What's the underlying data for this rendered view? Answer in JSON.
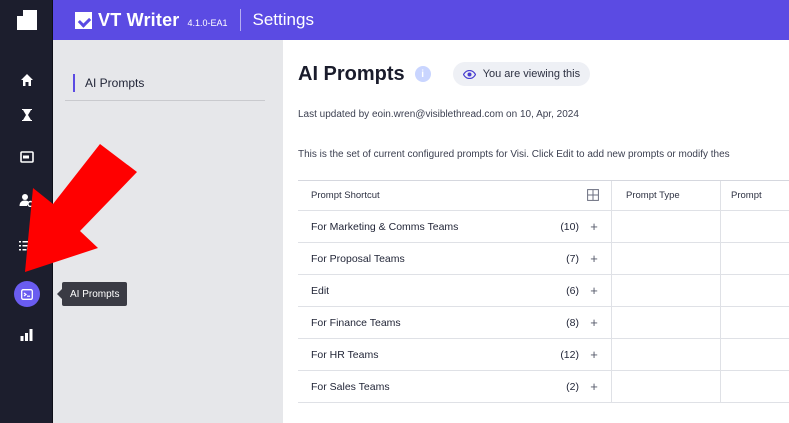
{
  "app": {
    "name": "VT Writer",
    "version": "4.1.0-EA1",
    "section": "Settings"
  },
  "rail": {
    "items": [
      {
        "icon": "home-icon"
      },
      {
        "icon": "hourglass-icon"
      },
      {
        "icon": "document-icon"
      },
      {
        "icon": "user-settings-icon"
      },
      {
        "icon": "list-search-icon"
      },
      {
        "icon": "terminal-icon",
        "active": true
      },
      {
        "icon": "bar-chart-icon"
      }
    ],
    "tooltip": "AI Prompts"
  },
  "subnav": {
    "items": [
      {
        "label": "AI Prompts",
        "active": true
      }
    ]
  },
  "page": {
    "title": "AI Prompts",
    "info_symbol": "i",
    "view_badge": "You are viewing this",
    "last_updated": "Last updated by eoin.wren@visiblethread.com on 10, Apr, 2024",
    "description": "This is the set of current configured prompts for Visi. Click Edit to add new prompts or modify thes"
  },
  "table": {
    "headers": {
      "shortcut": "Prompt Shortcut",
      "type": "Prompt Type",
      "prompt": "Prompt"
    },
    "rows": [
      {
        "name": "For Marketing & Comms Teams",
        "count": "(10)",
        "action": "+"
      },
      {
        "name": "For Proposal Teams",
        "count": "(7)",
        "action": "+"
      },
      {
        "name": "Edit",
        "count": "(6)",
        "action": "+"
      },
      {
        "name": "For Finance Teams",
        "count": "(8)",
        "action": "+"
      },
      {
        "name": "For HR Teams",
        "count": "(12)",
        "action": "+"
      },
      {
        "name": "For Sales Teams",
        "count": "(2)",
        "action": "+"
      }
    ]
  },
  "colors": {
    "header_bg": "#5b4be3",
    "rail_bg": "#1c1e2d",
    "active_accent": "#6a5cf0",
    "annotation_arrow": "#ff0000"
  }
}
